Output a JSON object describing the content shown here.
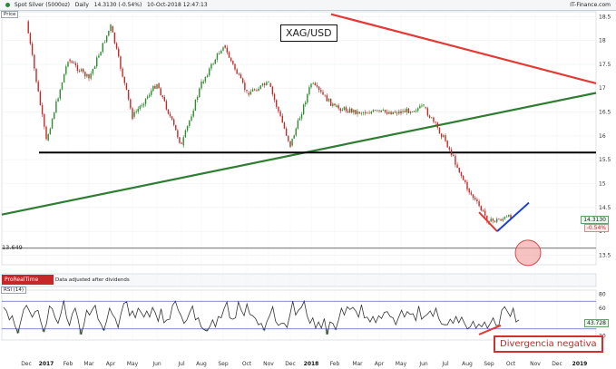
{
  "header": {
    "instrument": "Spot Silver (5000oz)",
    "timeframe": "Daily",
    "price_change": "14.3130 (-0.54%)",
    "datetime": "10-Oct-2018 12:47:13",
    "source": "IT-Finance.com"
  },
  "labels": {
    "price_axis_caption": "Price",
    "chart_title": "XAG/USD",
    "level_label": "13.649",
    "prorealtime_logo": "ProRealTime",
    "adjusted_note": "Data adjusted after dividends",
    "rsi_caption": "RSI (14)",
    "annotation": "Divergencia negativa"
  },
  "price_tags": {
    "last_price": "14.3130",
    "change_pct": "-0.54%",
    "rsi_value": "43.728"
  },
  "colors": {
    "up_candle": "#2e8b2e",
    "down_candle": "#c62828",
    "resistance_trend": "#e53935",
    "support_trend": "#2e7d32",
    "horizontal_support": "#000000",
    "rising_line": "#1e3fd1",
    "falling_line": "#e53935",
    "rsi_line": "#333333",
    "rsi_oversold_fill": "#5aa05a"
  },
  "chart_data": {
    "type": "line",
    "title": "XAG/USD",
    "x_axis": {
      "ticks": [
        "Dec",
        "2017",
        "Feb",
        "Mar",
        "Apr",
        "May",
        "Jun",
        "Jul",
        "Aug",
        "Sep",
        "Oct",
        "Nov",
        "Dec",
        "2018",
        "Feb",
        "Mar",
        "Apr",
        "May",
        "Jun",
        "Jul",
        "Aug",
        "Sep",
        "Oct",
        "Nov",
        "Dec",
        "2019"
      ],
      "bold_ticks": [
        "2017",
        "2018",
        "2019"
      ]
    },
    "y_axis": {
      "ticks": [
        13.5,
        14,
        14.5,
        15,
        15.5,
        16,
        16.5,
        17,
        17.5,
        18,
        18.5
      ],
      "range": [
        13.3,
        18.6
      ]
    },
    "series": [
      {
        "x": [
          "Dec",
          "2017",
          "Feb",
          "Mar",
          "Apr",
          "May",
          "Jun",
          "Jul",
          "Aug",
          "Sep",
          "Oct",
          "Nov",
          "Dec",
          "2018",
          "Feb",
          "Mar",
          "Apr",
          "May",
          "Jun",
          "Jul",
          "Aug",
          "Sep",
          "Oct"
        ],
        "values": [
          18.4,
          15.9,
          17.6,
          17.2,
          18.3,
          16.4,
          17.1,
          15.8,
          17.1,
          17.9,
          16.9,
          17.1,
          15.8,
          17.1,
          16.6,
          16.5,
          16.5,
          16.5,
          16.6,
          15.9,
          14.9,
          14.2,
          14.3
        ]
      }
    ],
    "lines": {
      "horizontal_support": 15.65,
      "level": 13.649,
      "upper_trendline": [
        [
          0,
          18.55
        ],
        [
          1,
          17.1
        ]
      ],
      "lower_trendline": [
        [
          0,
          14.35
        ],
        [
          1,
          16.9
        ]
      ]
    },
    "rsi": {
      "label": "RSI (14)",
      "ticks": [
        20,
        40,
        60,
        80
      ],
      "range": [
        14,
        86
      ],
      "overbought": 70,
      "oversold": 30,
      "current": 43.728,
      "values": [
        61,
        56,
        43,
        49,
        34,
        24,
        41,
        58,
        64,
        56,
        47,
        55,
        57,
        40,
        26,
        38,
        63,
        59,
        46,
        38,
        52,
        71,
        46,
        35,
        52,
        60,
        44,
        22,
        35,
        57,
        50,
        58,
        64,
        44,
        37,
        28,
        42,
        60,
        51,
        45,
        32,
        52,
        67,
        69,
        49,
        56,
        46,
        60,
        54,
        47,
        56,
        47,
        61,
        53,
        41,
        59,
        39,
        43,
        44,
        64,
        70,
        57,
        49,
        38,
        43,
        54,
        63,
        43,
        46,
        33,
        29,
        27,
        33,
        43,
        33,
        48,
        46,
        59,
        69,
        46,
        44,
        46,
        69,
        57,
        49,
        66,
        51,
        49,
        45,
        36,
        38,
        28,
        41,
        50,
        62,
        41,
        35,
        38,
        38,
        32,
        50,
        70,
        50,
        57,
        61,
        70,
        49,
        38,
        46,
        31,
        40,
        31,
        45,
        22,
        40,
        38,
        29,
        43,
        60,
        50,
        62,
        58,
        61,
        56,
        47,
        65,
        46,
        47,
        40,
        48,
        39,
        49,
        45,
        54,
        55,
        48,
        46,
        36,
        47,
        57,
        47,
        55,
        51,
        52,
        42,
        63,
        44,
        48,
        51,
        56,
        48,
        60,
        45,
        37,
        36,
        36,
        44,
        38,
        48,
        39,
        47,
        38,
        30,
        33,
        41,
        31,
        37,
        33,
        40,
        31,
        38,
        46,
        35,
        35,
        57,
        62,
        55,
        48,
        60,
        40,
        43
      ]
    }
  }
}
